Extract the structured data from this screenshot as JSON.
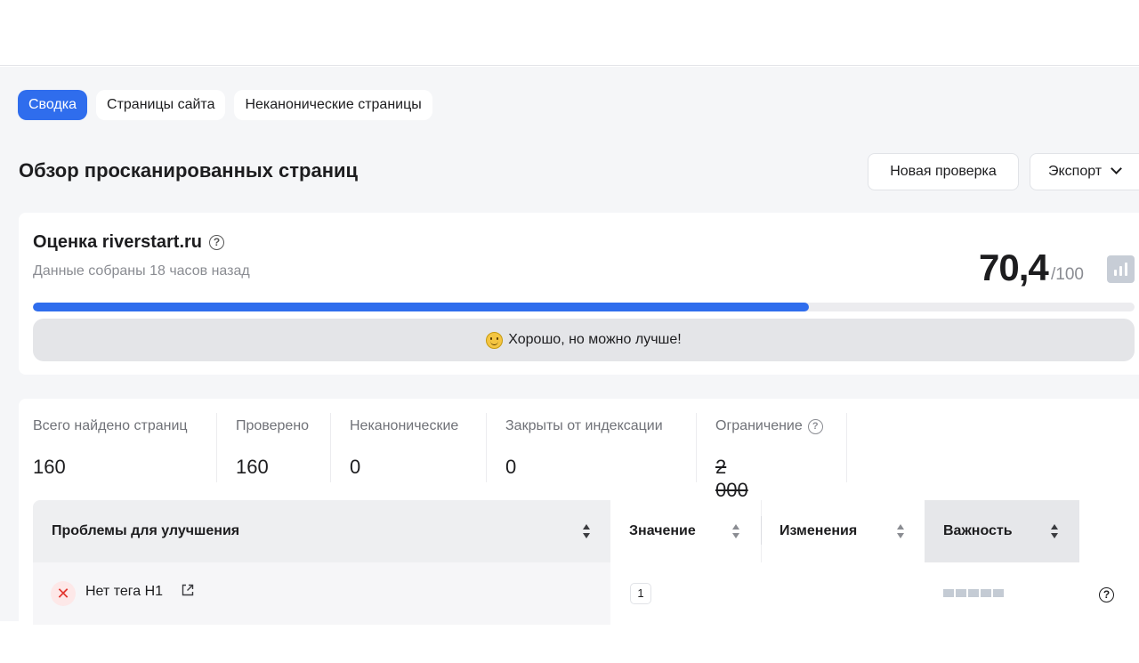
{
  "tabs": [
    {
      "label": "Сводка",
      "active": true
    },
    {
      "label": "Страницы сайта",
      "active": false
    },
    {
      "label": "Неканонические страницы",
      "active": false
    }
  ],
  "page_title": "Обзор просканированных страниц",
  "actions": {
    "new_check": "Новая проверка",
    "export": "Экспорт"
  },
  "score": {
    "title": "Оценка riverstart.ru",
    "subtitle": "Данные собраны 18 часов назад",
    "value": "70,4",
    "max": "/100",
    "progress_percent": 70.4,
    "verdict": "Хорошо, но можно лучше!",
    "accent_color": "#2f6ded"
  },
  "stats": [
    {
      "label": "Всего найдено страниц",
      "value": "160"
    },
    {
      "label": "Проверено",
      "value": "160"
    },
    {
      "label": "Неканонические",
      "value": "0"
    },
    {
      "label": "Закрыты от индексации",
      "value": "0"
    },
    {
      "label": "Ограничение",
      "value": "2 000"
    }
  ],
  "table": {
    "columns": {
      "problems": "Проблемы для улучшения",
      "value": "Значение",
      "changes": "Изменения",
      "importance": "Важность"
    },
    "rows": [
      {
        "label": "Нет тега H1",
        "value": "1",
        "status_icon": "close-icon",
        "importance_level": 5
      }
    ]
  }
}
